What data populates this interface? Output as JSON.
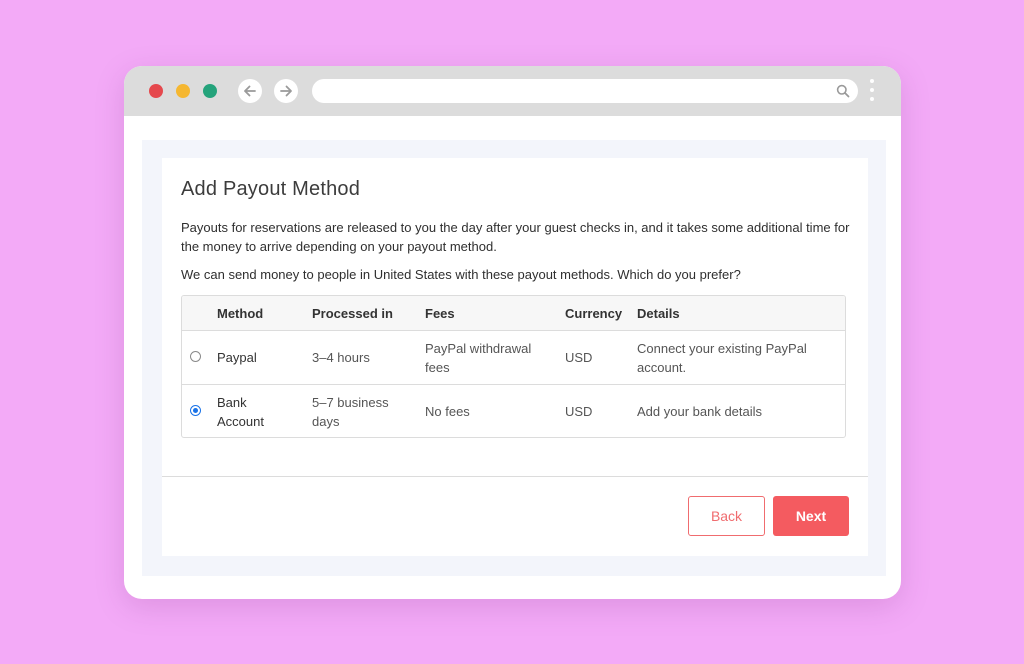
{
  "browser": {
    "icons": [
      "close-dot",
      "minimize-dot",
      "maximize-dot",
      "arrow-left-icon",
      "arrow-right-icon",
      "search-icon",
      "kebab-menu-icon"
    ],
    "colors": {
      "red": "#e5484d",
      "yellow": "#f5b731",
      "green": "#24a37b",
      "background": "#f3aaf7"
    }
  },
  "page": {
    "title": "Add Payout Method",
    "intro": "Payouts for reservations are released to you the day after your guest checks in, and it takes some additional time for the money to arrive depending on your payout method.",
    "question": "We can send money to people in United States with these payout methods. Which do you prefer?"
  },
  "table": {
    "headers": [
      "Method",
      "Processed in",
      "Fees",
      "Currency",
      "Details"
    ],
    "rows": [
      {
        "selected": false,
        "method": "Paypal",
        "processed": "3–4 hours",
        "fees": "PayPal withdrawal fees",
        "currency": "USD",
        "details": "Connect your existing PayPal account."
      },
      {
        "selected": true,
        "method": "Bank Account",
        "processed": "5–7 business days",
        "fees": "No fees",
        "currency": "USD",
        "details": "Add your bank details"
      }
    ]
  },
  "actions": {
    "back_label": "Back",
    "next_label": "Next",
    "accent": "#f45b60"
  }
}
